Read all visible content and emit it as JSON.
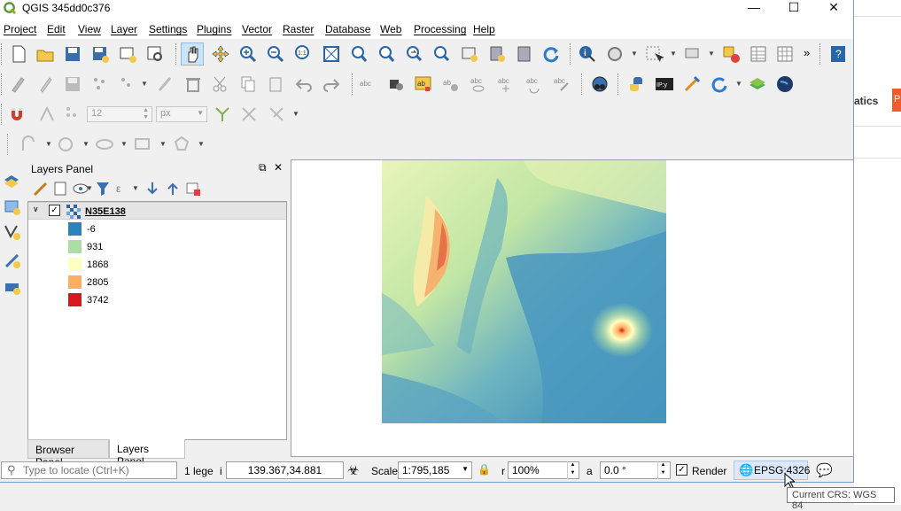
{
  "window": {
    "title": "QGIS 345dd0c376"
  },
  "menu": [
    "Project",
    "Edit",
    "View",
    "Layer",
    "Settings",
    "Plugins",
    "Vector",
    "Raster",
    "Database",
    "Web",
    "Processing",
    "Help"
  ],
  "digitize": {
    "snap_tolerance": "12",
    "snap_unit": "px"
  },
  "layers_panel": {
    "title": "Layers Panel",
    "layer": {
      "name": "N35E138",
      "checked": true
    },
    "legend": [
      {
        "label": "-6",
        "color": "#2b83ba"
      },
      {
        "label": "931",
        "color": "#abdda4"
      },
      {
        "label": "1868",
        "color": "#ffffbf"
      },
      {
        "label": "2805",
        "color": "#fdae61"
      },
      {
        "label": "3742",
        "color": "#d7191c"
      }
    ],
    "tabs": [
      "Browser Panel",
      "Layers Panel"
    ],
    "active_tab": "Layers Panel"
  },
  "statusbar": {
    "locate_placeholder": "Type to locate (Ctrl+K)",
    "legend_msg": "1 lege",
    "coord_prefix": "i",
    "coordinate": "139.367,34.881",
    "scale_label": "Scale",
    "scale_value": "1:795,185",
    "magnifier_prefix": "r",
    "magnifier_value": "100%",
    "rotation_prefix": "a",
    "rotation_value": "0.0 °",
    "render_label": "Render",
    "render_checked": true,
    "crs": "EPSG:4326"
  },
  "tooltip": "Current CRS: WGS 84",
  "background_app": {
    "partial_text": "atics",
    "button_text": "P"
  }
}
